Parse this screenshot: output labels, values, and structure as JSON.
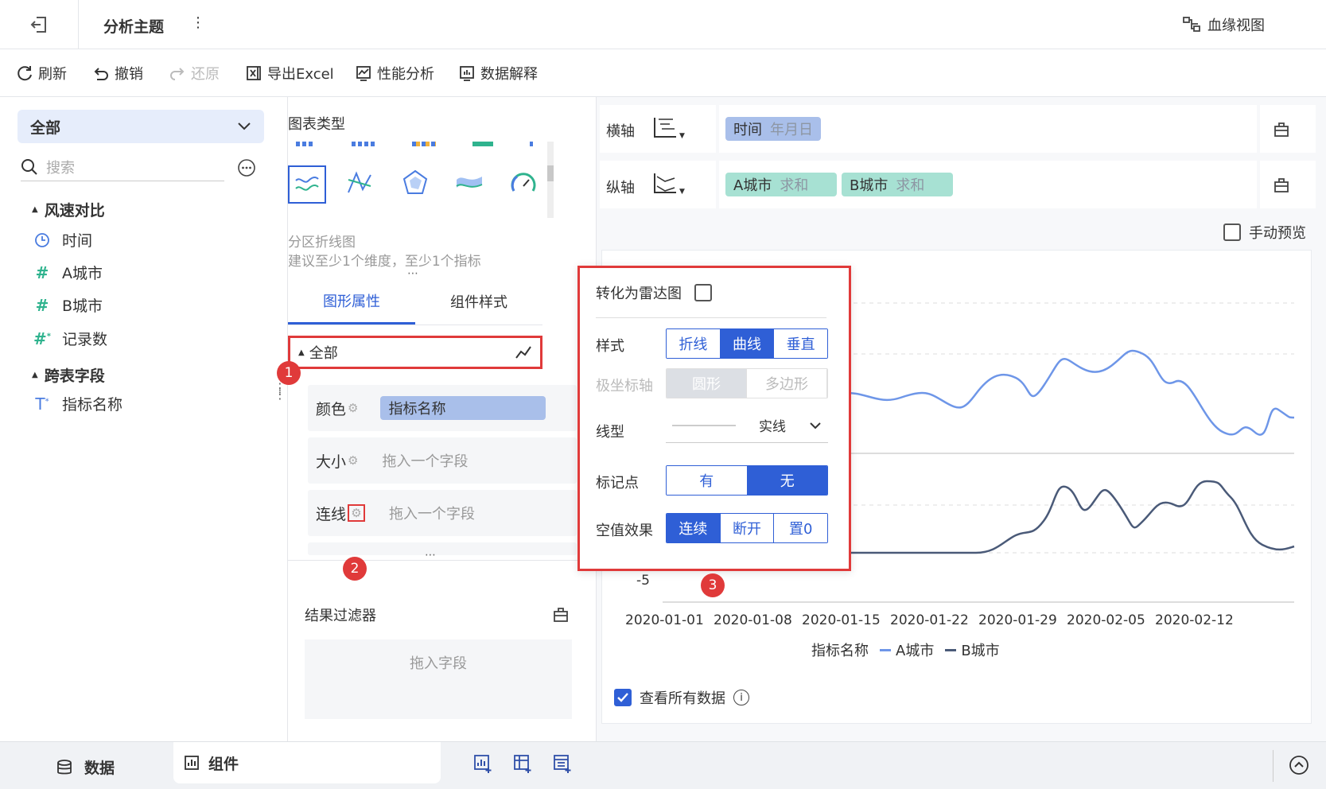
{
  "topbar": {
    "title": "分析主题",
    "more": "⋮",
    "lineage_label": "血缘视图"
  },
  "toolbar": {
    "refresh": "刷新",
    "undo": "撤销",
    "redo": "还原",
    "export_excel": "导出Excel",
    "perf_analysis": "性能分析",
    "data_explain": "数据解释"
  },
  "left": {
    "dropdown_value": "全部",
    "search_placeholder": "搜索",
    "groups": [
      {
        "title": "风速对比",
        "fields": [
          {
            "icon": "clock-icon",
            "label": "时间"
          },
          {
            "icon": "hash-icon",
            "label": "A城市"
          },
          {
            "icon": "hash-icon",
            "label": "B城市"
          },
          {
            "icon": "hash-star-icon",
            "label": "记录数"
          }
        ]
      },
      {
        "title": "跨表字段",
        "fields": [
          {
            "icon": "text-star-icon",
            "label": "指标名称"
          }
        ]
      }
    ]
  },
  "mid": {
    "chart_type_title": "图表类型",
    "chart_name": "分区折线图",
    "chart_hint": "建议至少1个维度，至少1个指标",
    "tabs": [
      "图形属性",
      "组件样式"
    ],
    "all_label": "全部",
    "attrs": [
      {
        "label": "颜色",
        "value": "指标名称",
        "placeholder": ""
      },
      {
        "label": "大小",
        "value": "",
        "placeholder": "拖入一个字段"
      },
      {
        "label": "连线",
        "value": "",
        "placeholder": "拖入一个字段"
      }
    ],
    "filter_title": "结果过滤器",
    "filter_placeholder": "拖入字段"
  },
  "right": {
    "x_axis_label": "横轴",
    "y_axis_label": "纵轴",
    "x_pill": {
      "name": "时间",
      "sub": "年月日"
    },
    "y_pills": [
      {
        "name": "A城市",
        "sub": "求和"
      },
      {
        "name": "B城市",
        "sub": "求和"
      }
    ],
    "manual_preview": "手动预览",
    "legend_title": "指标名称",
    "view_all": "查看所有数据",
    "y_tick_bottom": "-5"
  },
  "popup": {
    "radar_label": "转化为雷达图",
    "style_label": "样式",
    "style_options": [
      "折线",
      "曲线",
      "垂直"
    ],
    "polar_label": "极坐标轴",
    "polar_options": [
      "圆形",
      "多边形"
    ],
    "line_type_label": "线型",
    "line_type_value": "实线",
    "marker_label": "标记点",
    "marker_options": [
      "有",
      "无"
    ],
    "null_label": "空值效果",
    "null_options": [
      "连续",
      "断开",
      "置0"
    ]
  },
  "badges": [
    "1",
    "2",
    "3"
  ],
  "bottom": {
    "data_tab": "数据",
    "component_tab": "组件"
  },
  "colors": {
    "accent": "#2f5fd6",
    "series_a": "#6e96e8",
    "series_b": "#4a5a78",
    "highlight": "#e03a3a"
  },
  "chart_data": {
    "type": "line",
    "x": [
      "2020-01-01",
      "2020-01-08",
      "2020-01-15",
      "2020-01-22",
      "2020-01-29",
      "2020-02-05",
      "2020-02-12"
    ],
    "series": [
      {
        "name": "A城市"
      },
      {
        "name": "B城市"
      }
    ]
  }
}
